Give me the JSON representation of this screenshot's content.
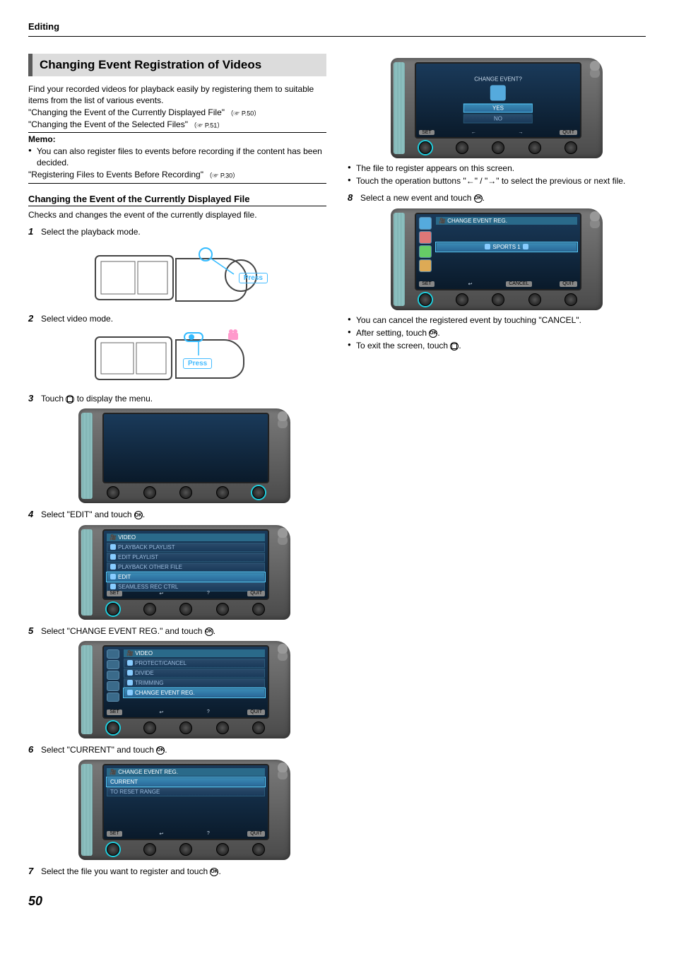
{
  "header": {
    "section": "Editing"
  },
  "title": "Changing Event Registration of Videos",
  "intro": "Find your recorded videos for playback easily by registering them to suitable items from the list of various events.",
  "link1": {
    "text": "\"Changing the Event of the Currently Displayed File\"",
    "ref": "（☞ P.50）"
  },
  "link2": {
    "text": "\"Changing the Event of the Selected Files\"",
    "ref": "（☞ P.51）"
  },
  "memo": {
    "label": "Memo:",
    "bullet1": "You can also register files to events before recording if the content has been decided.",
    "link": {
      "text": "\"Registering Files to Events Before Recording\"",
      "ref": "（☞ P.30）"
    }
  },
  "subheading": "Changing the Event of the Currently Displayed File",
  "subdesc": "Checks and changes the event of the currently displayed file.",
  "steps": {
    "s1": "Select the playback mode.",
    "s2": "Select video mode.",
    "s3_a": "Touch ",
    "s3_b": " to display the menu.",
    "s4_a": "Select \"EDIT\" and touch ",
    "s4_b": ".",
    "s5_a": "Select \"CHANGE EVENT REG.\" and touch ",
    "s5_b": ".",
    "s6_a": "Select \"CURRENT\" and touch ",
    "s6_b": ".",
    "s7_a": "Select the file you want to register and touch ",
    "s7_b": ".",
    "s8_a": "Select a new event and touch ",
    "s8_b": "."
  },
  "screens": {
    "press": "Press",
    "s4": {
      "header": "VIDEO",
      "items": [
        "PLAYBACK PLAYLIST",
        "EDIT PLAYLIST",
        "PLAYBACK OTHER FILE",
        "EDIT",
        "SEAMLESS REC CTRL"
      ],
      "selIndex": 3
    },
    "s5": {
      "header": "VIDEO",
      "items": [
        "PROTECT/CANCEL",
        "DIVIDE",
        "TRIMMING",
        "CHANGE EVENT REG."
      ],
      "selIndex": 3
    },
    "s6": {
      "header": "CHANGE EVENT REG.",
      "items": [
        "CURRENT",
        "TO RESET RANGE"
      ],
      "selIndex": 0
    },
    "s7dlg": {
      "title": "CHANGE EVENT?",
      "yes": "YES",
      "no": "NO"
    },
    "s8": {
      "header": "CHANGE EVENT REG.",
      "sel": "SPORTS 1"
    },
    "soft": {
      "set": "SET",
      "back": "↩",
      "q": "?",
      "quit": "QUIT",
      "left": "←",
      "right": "→",
      "cancel": "CANCEL"
    }
  },
  "rightNotes": {
    "b1": "The file to register appears on this screen.",
    "b2": "Touch the operation buttons \"←\" / \"→\" to select the previous or next file.",
    "b3": "You can cancel the registered event by touching \"CANCEL\".",
    "b4_a": "After setting, touch ",
    "b4_b": ".",
    "b5_a": "To exit the screen, touch ",
    "b5_b": "."
  },
  "pageNumber": "50"
}
